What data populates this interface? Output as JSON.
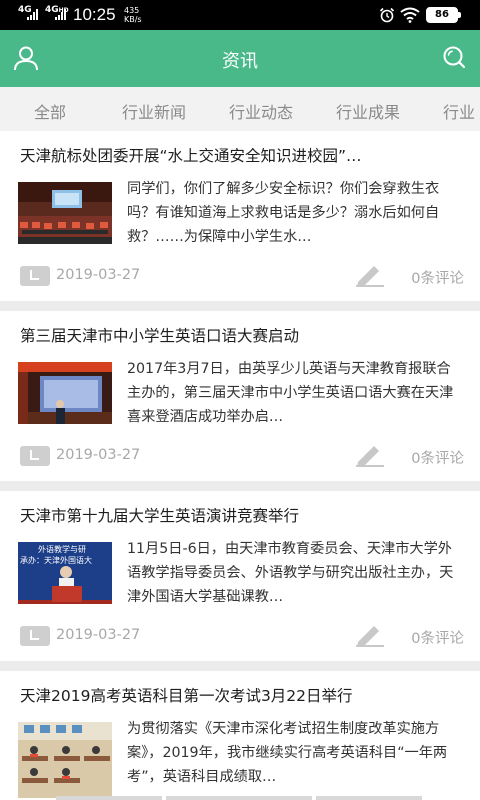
{
  "status_bar": {
    "net1": "4G",
    "net2": "4G",
    "net2_sup": "HD",
    "time": "10:25",
    "speed_value": "435",
    "speed_unit": "KB/s",
    "battery": "86"
  },
  "header": {
    "title": "资讯",
    "left_icon": "user-icon",
    "right_icon": "search-icon",
    "color": "#49b98a"
  },
  "tabs": [
    "全部",
    "行业新闻",
    "行业动态",
    "行业成果",
    "行业"
  ],
  "articles": [
    {
      "title": "天津航标处团委开展“水上交通安全知识进校园”…",
      "excerpt": "同学们，你们了解多少安全标识？你们会穿救生衣吗？有谁知道海上求救电话是多少？溺水后如何自救？……为保障中小学生水…",
      "date": "2019-03-27",
      "comments": "0条评论"
    },
    {
      "title": "第三届天津市中小学生英语口语大赛启动",
      "excerpt": "2017年3月7日，由英孚少儿英语与天津教育报联合主办的，第三届天津市中小学生英语口语大赛在天津喜来登酒店成功举办启…",
      "date": "2019-03-27",
      "comments": "0条评论"
    },
    {
      "title": "天津市第十九届大学生英语演讲竞赛举行",
      "excerpt": "11月5日-6日，由天津市教育委员会、天津市大学外语教学指导委员会、外语教学与研究出版社主办，天津外国语大学基础课教…",
      "date": "2019-03-27",
      "comments": "0条评论",
      "thumb_text_1": "外语教学与研",
      "thumb_text_2": "承办：天津外国语大"
    },
    {
      "title": "天津2019高考英语科目第一次考试3月22日举行",
      "excerpt": "为贯彻落实《天津市深化考试招生制度改革实施方案》，2019年，我市继续实行高考英语科目“一年两考”，英语科目成绩取…"
    }
  ]
}
